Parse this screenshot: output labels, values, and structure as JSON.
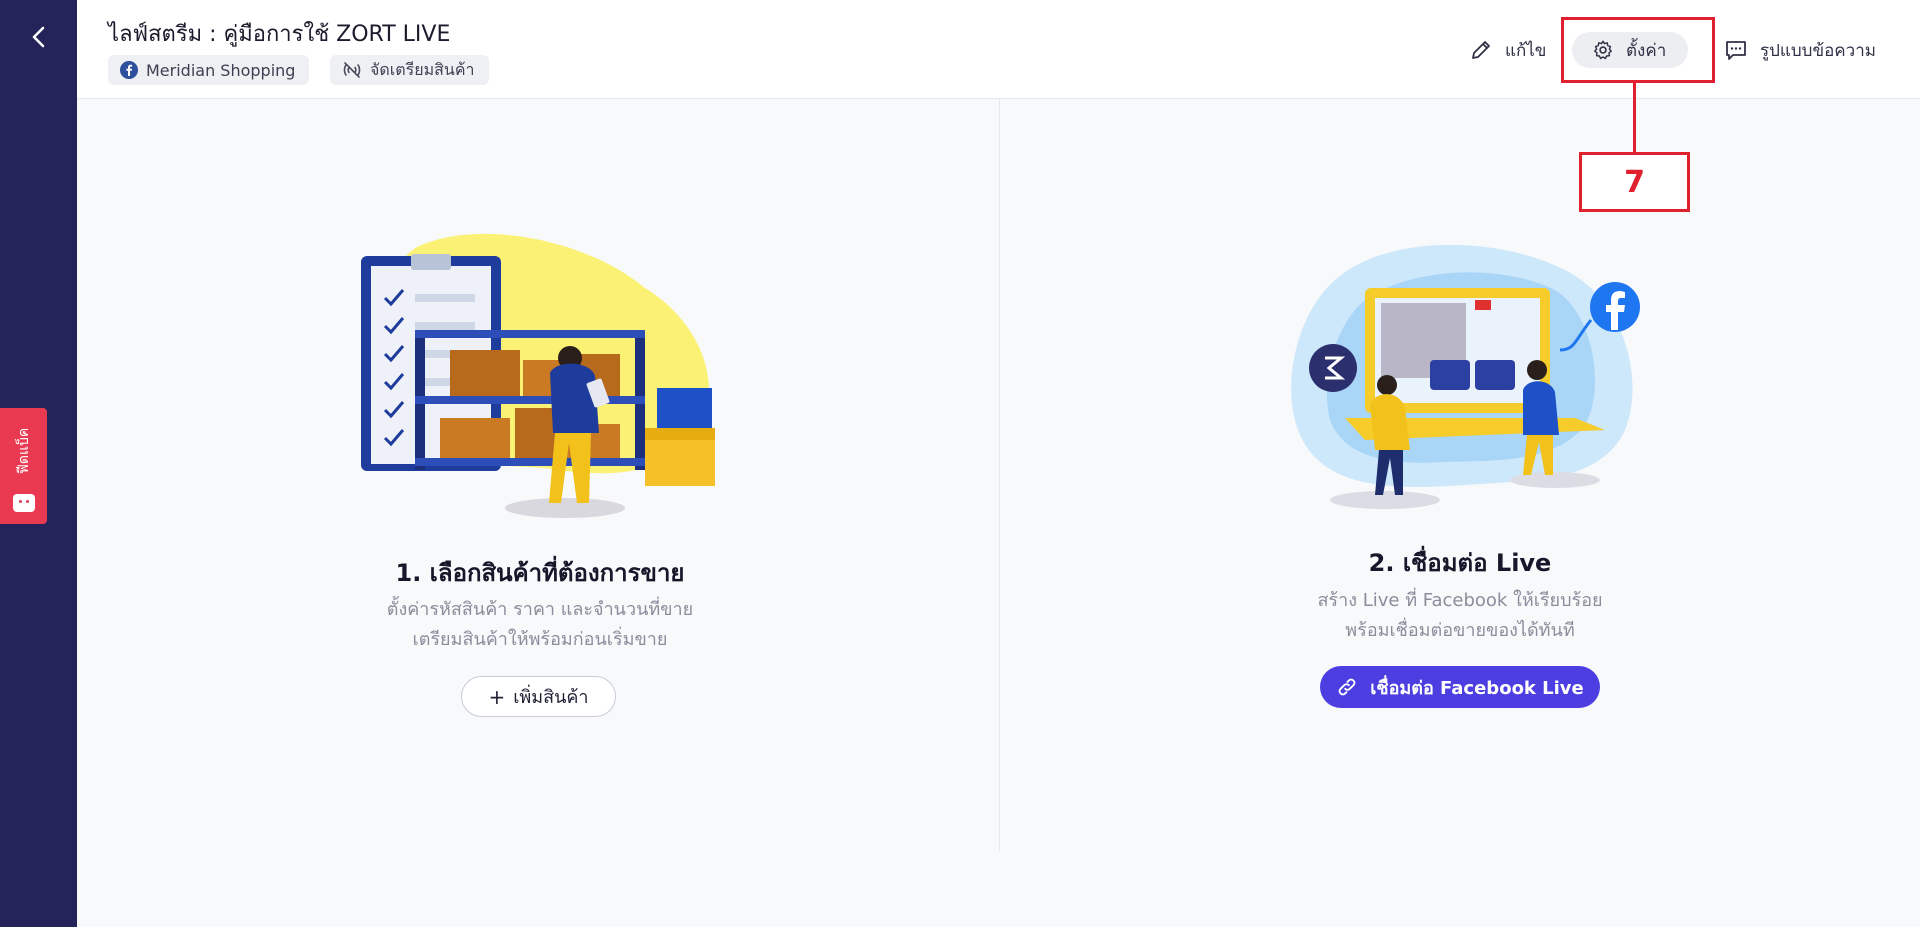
{
  "sidebar": {
    "back_icon": "chevron-left-icon",
    "feedback_label": "ฟีดแบ็ค"
  },
  "header": {
    "title": "ไลฟ์สตรีม : คู่มือการใช้ ZORT LIVE",
    "page_chip": "Meridian Shopping",
    "status_chip": "จัดเตรียมสินค้า",
    "actions": {
      "edit": "แก้ไข",
      "settings": "ตั้งค่า",
      "message_format": "รูปแบบข้อความ"
    }
  },
  "annotation": {
    "number": "7",
    "color": "#e0202e"
  },
  "step1": {
    "title": "1. เลือกสินค้าที่ต้องการขาย",
    "desc_line1": "ตั้งค่ารหัสสินค้า ราคา และจำนวนที่ขาย",
    "desc_line2": "เตรียมสินค้าให้พร้อมก่อนเริ่มขาย",
    "button": "เพิ่มสินค้า"
  },
  "step2": {
    "title": "2. เชื่อมต่อ Live",
    "desc_line1": "สร้าง Live ที่ Facebook ให้เรียบร้อย",
    "desc_line2": "พร้อมเชื่อมต่อขายของได้ทันที",
    "button": "เชื่อมต่อ Facebook Live"
  },
  "colors": {
    "sidebar": "#24235a",
    "primary": "#4c3ee0",
    "feedback": "#e93a52"
  }
}
